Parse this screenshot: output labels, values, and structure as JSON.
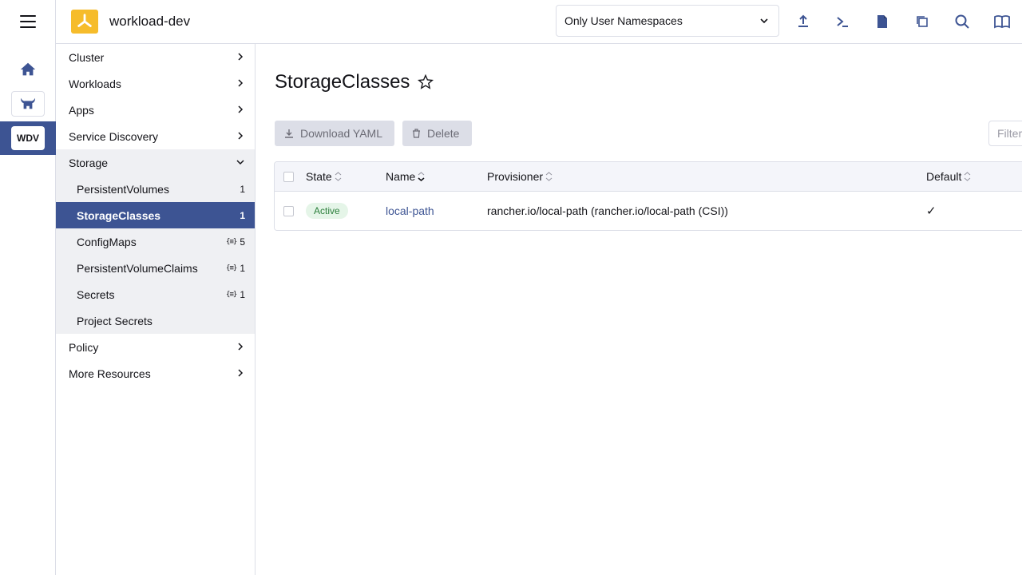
{
  "header": {
    "cluster_name": "workload-dev",
    "namespace_filter": "Only User Namespaces"
  },
  "rail": {
    "cluster_badge": "WDV"
  },
  "sidenav": {
    "groups": {
      "cluster": "Cluster",
      "workloads": "Workloads",
      "apps": "Apps",
      "service_discovery": "Service Discovery",
      "storage": "Storage",
      "policy": "Policy",
      "more_resources": "More Resources"
    },
    "storage_items": [
      {
        "label": "PersistentVolumes",
        "count": "1",
        "namespaced": false
      },
      {
        "label": "StorageClasses",
        "count": "1",
        "namespaced": false,
        "active": true
      },
      {
        "label": "ConfigMaps",
        "count": "5",
        "namespaced": true
      },
      {
        "label": "PersistentVolumeClaims",
        "count": "1",
        "namespaced": true
      },
      {
        "label": "Secrets",
        "count": "1",
        "namespaced": true
      },
      {
        "label": "Project Secrets",
        "count": "",
        "namespaced": false
      }
    ],
    "namespaced_icon": "{≡}"
  },
  "main": {
    "title": "StorageClasses",
    "download_yaml": "Download YAML",
    "delete": "Delete",
    "filter_placeholder": "Filter"
  },
  "table": {
    "columns": [
      "State",
      "Name",
      "Provisioner",
      "Default"
    ],
    "rows": [
      {
        "state": "Active",
        "name": "local-path",
        "provisioner": "rancher.io/local-path (rancher.io/local-path (CSI))",
        "default": "✓"
      }
    ]
  },
  "colors": {
    "accent": "#3d5493",
    "logo": "#f6bc2b",
    "active_badge_bg": "#e5f5e8",
    "active_badge_text": "#2c7f3c"
  }
}
